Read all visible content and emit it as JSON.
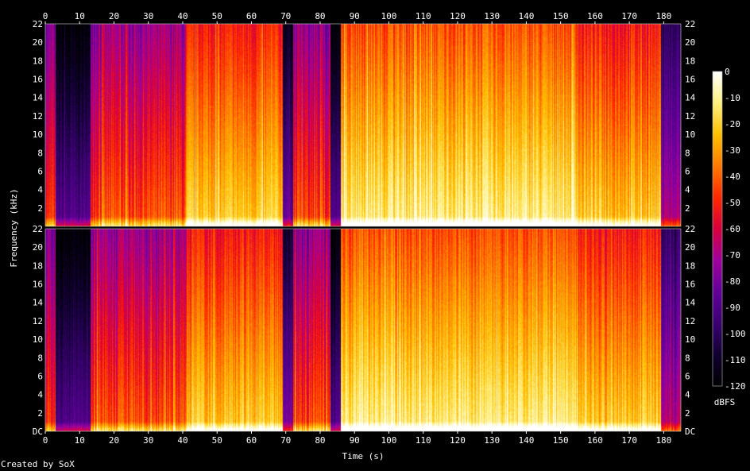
{
  "chart_data": {
    "type": "heatmap",
    "title": "",
    "xlabel": "Time (s)",
    "ylabel": "Frequency (kHz)",
    "x_ticks": [
      0,
      10,
      20,
      30,
      40,
      50,
      60,
      70,
      80,
      90,
      100,
      110,
      120,
      130,
      140,
      150,
      160,
      170,
      180
    ],
    "y_ticks": [
      "DC",
      "2",
      "4",
      "6",
      "8",
      "10",
      "12",
      "14",
      "16",
      "18",
      "20",
      "22"
    ],
    "xlim": [
      0,
      185
    ],
    "ylim_khz": [
      0,
      22
    ],
    "channels": 2,
    "colorbar": {
      "label": "dBFS",
      "ticks": [
        0,
        -10,
        -20,
        -30,
        -40,
        -50,
        -60,
        -70,
        -80,
        -90,
        -100,
        -110,
        -120
      ],
      "range": [
        -120,
        0
      ],
      "colors": [
        "#000000",
        "#100030",
        "#3a0070",
        "#62009a",
        "#a0009c",
        "#d8003c",
        "#ff2800",
        "#ff7a00",
        "#ffc000",
        "#fff080",
        "#ffffff"
      ]
    },
    "segments": [
      {
        "start": 0,
        "end": 3,
        "level": 0.55,
        "noise": 0.08
      },
      {
        "start": 3,
        "end": 13,
        "level": 0.22,
        "noise": 0.05
      },
      {
        "start": 13,
        "end": 41,
        "level": 0.6,
        "noise": 0.1
      },
      {
        "start": 41,
        "end": 69,
        "level": 0.78,
        "noise": 0.08
      },
      {
        "start": 69,
        "end": 72,
        "level": 0.28,
        "noise": 0.06
      },
      {
        "start": 72,
        "end": 83,
        "level": 0.58,
        "noise": 0.1
      },
      {
        "start": 83,
        "end": 86,
        "level": 0.22,
        "noise": 0.05
      },
      {
        "start": 86,
        "end": 155,
        "level": 0.86,
        "noise": 0.08
      },
      {
        "start": 155,
        "end": 179,
        "level": 0.78,
        "noise": 0.09
      },
      {
        "start": 179,
        "end": 185,
        "level": 0.38,
        "noise": 0.07
      }
    ]
  },
  "footer": {
    "credit": "Created by SoX"
  }
}
